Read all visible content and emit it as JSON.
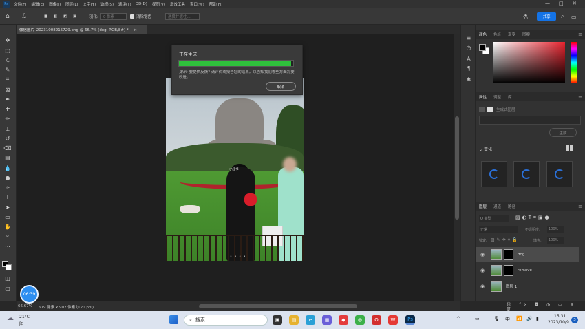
{
  "app": {
    "logo": "Ps"
  },
  "menu": [
    "文件(F)",
    "编辑(E)",
    "图像(I)",
    "图层(L)",
    "文字(Y)",
    "选择(S)",
    "滤镜(T)",
    "3D(D)",
    "视图(V)",
    "增效工具",
    "窗口(W)",
    "帮助(H)"
  ],
  "options": {
    "feather_label": "羽化:",
    "feather_value": "0 像素",
    "antialias_label": "消除锯齿",
    "select_mask_label": "选择并遮住...",
    "share_label": "共享"
  },
  "document_tab": {
    "title": "微信图片_20231008215729.png @ 66.7% (dog, RGB/8#) *",
    "close": "×"
  },
  "photo": {
    "tag_text": "小红书"
  },
  "dialog": {
    "title": "正在生成",
    "progress": 0.98,
    "hint_prefix": "提示:",
    "hint_text": "要提供反馈? 请评价或报告您的结果。以告知我们哪些方面需要改进。",
    "cancel_label": "取消"
  },
  "panels": {
    "color_tabs": [
      "颜色",
      "色板",
      "渐变",
      "图案"
    ],
    "props_tabs": [
      "属性",
      "调整",
      "库"
    ],
    "generate_layer_label": "生成式图层",
    "generate_button": "生成",
    "variants_label": "变化",
    "layers_tabs": [
      "图层",
      "通道",
      "路径"
    ],
    "kind_label": "Q 类型",
    "blend_mode": "正常",
    "opacity_label": "不透明度:",
    "opacity_value": "100%",
    "lock_label": "锁定:",
    "fill_label": "填充:",
    "fill_value": "100%",
    "layers": [
      {
        "name": "dog",
        "selected": true
      },
      {
        "name": "remove",
        "selected": false
      },
      {
        "name": "图层 1",
        "selected": false
      }
    ]
  },
  "statusbar": {
    "zoom": "66.67%",
    "info": "679 像素 x 902 像素 (120 ppi)"
  },
  "timer": "06:39",
  "taskbar": {
    "weather_temp": "21°C",
    "weather_desc": "阴",
    "search_label": "搜索",
    "ime": "中",
    "time": "15:31",
    "date": "2023/10/9",
    "notify_count": "3"
  },
  "colors": {
    "accent": "#1473e6",
    "progress": "#2fc13c",
    "spinner": "#2a6fd6"
  }
}
